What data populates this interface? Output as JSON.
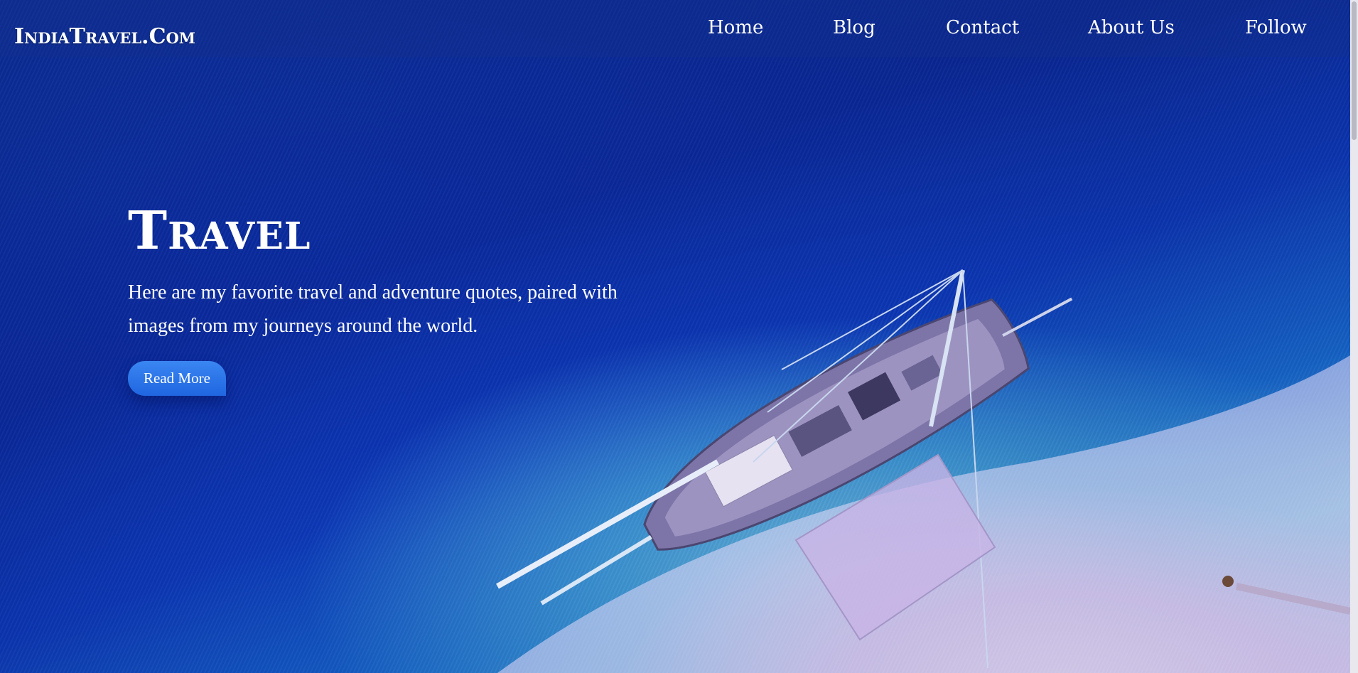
{
  "site": {
    "logo": "IndiaTravel.Com"
  },
  "nav": {
    "items": [
      {
        "label": "Home"
      },
      {
        "label": "Blog"
      },
      {
        "label": "Contact"
      },
      {
        "label": "About Us"
      },
      {
        "label": "Follow"
      }
    ]
  },
  "hero": {
    "title": "Travel",
    "text": "Here are my favorite travel and adventure quotes, paired with images from my journeys around the world.",
    "button_label": "Read More"
  },
  "colors": {
    "accent": "#1f66e0",
    "ocean_dark": "#0c2f9c",
    "shallow": "#6fd4f2",
    "sand": "#d9c8f2"
  }
}
